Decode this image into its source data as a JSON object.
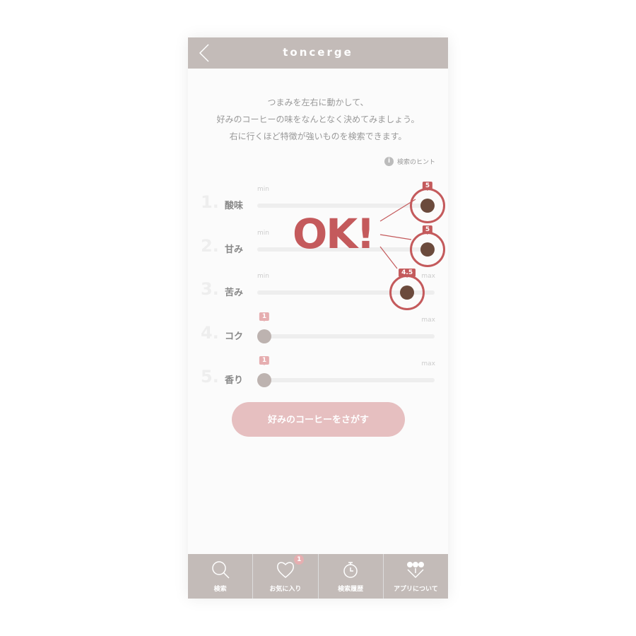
{
  "header": {
    "title": "toncerge",
    "back": "back-icon"
  },
  "intro": [
    "つまみを左右に動かして、",
    "好みのコーヒーの味をなんとなく決めてみましょう。",
    "右に行くほど特徴が強いものを検索できます。"
  ],
  "hint": {
    "icon": "i",
    "label": "検索のヒント"
  },
  "sliders": [
    {
      "num": "1.",
      "name": "酸味",
      "min": "min",
      "value": 5,
      "label": "5",
      "active": true
    },
    {
      "num": "2.",
      "name": "甘み",
      "min": "min",
      "value": 5,
      "label": "5",
      "active": true
    },
    {
      "num": "3.",
      "name": "苦み",
      "min": "min",
      "max": "max",
      "value": 4.5,
      "label": "4.5",
      "active": true
    },
    {
      "num": "4.",
      "name": "コク",
      "max": "max",
      "value": 1,
      "label": "1",
      "active": false
    },
    {
      "num": "5.",
      "name": "香り",
      "max": "max",
      "value": 1,
      "label": "1",
      "active": false
    }
  ],
  "slider_range": [
    1,
    5
  ],
  "overlay": {
    "text": "OK!"
  },
  "cta": "好みのコーヒーをさがす",
  "tabs": [
    {
      "label": "検索",
      "icon": "search-icon"
    },
    {
      "label": "お気に入り",
      "icon": "heart-icon",
      "badge": "1"
    },
    {
      "label": "検索履歴",
      "icon": "stopwatch-icon"
    },
    {
      "label": "アプリについて",
      "icon": "about-icon"
    }
  ],
  "colors": {
    "active": "#6b4a3c",
    "inactive": "#bdb3b0",
    "bubble_active": "#c45a5c",
    "bubble_inactive": "#e6aeb0",
    "accent": "#c45a5c"
  }
}
